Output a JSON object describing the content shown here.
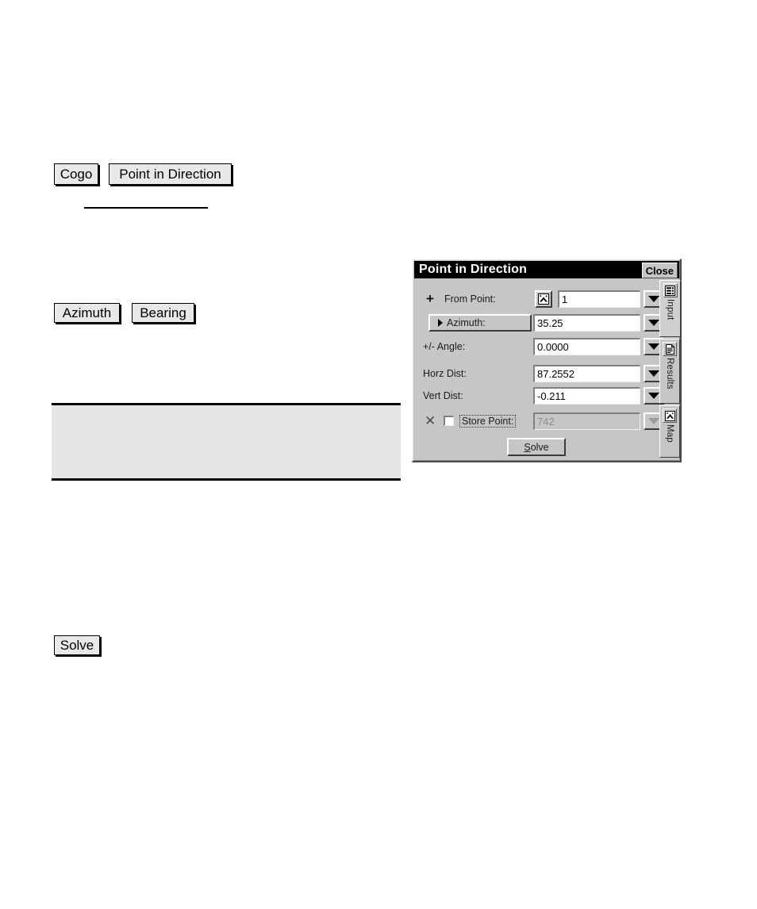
{
  "page": {
    "background": "#ffffff"
  },
  "doc_buttons": [
    {
      "name": "cogo-button",
      "label": "Cogo"
    },
    {
      "name": "point-in-direction-button",
      "label": "Point in Direction"
    },
    {
      "name": "azimuth-button",
      "label": "Azimuth"
    },
    {
      "name": "bearing-button",
      "label": "Bearing"
    },
    {
      "name": "solve-button",
      "label": "Solve"
    }
  ],
  "note_box": {
    "text": ""
  },
  "dialog": {
    "title": "Point in Direction",
    "close_label": "Close",
    "colors": {
      "face": "#c6c6c6",
      "titlebar": "#000000",
      "title_text": "#ffffff",
      "field_bg": "#ffffff",
      "disabled_text": "#8d8d8d"
    },
    "rows": [
      {
        "marker": "+",
        "label": "From Point:",
        "icon": "map-pick-icon",
        "value": "1",
        "dropdown": true,
        "disabled": false
      },
      {
        "button_label": "Azimuth:",
        "value": "35.25",
        "dropdown": true,
        "disabled": false
      },
      {
        "label": "+/- Angle:",
        "value": "0.0000",
        "dropdown": true,
        "disabled": false
      },
      {
        "label": "Horz Dist:",
        "value": "87.2552",
        "dropdown": true,
        "disabled": false
      },
      {
        "label": "Vert Dist:",
        "value": "-0.211",
        "dropdown": true,
        "disabled": false
      },
      {
        "marker": "✕",
        "checkbox": false,
        "label": "Store Point:",
        "value": "742",
        "dropdown": true,
        "disabled": true
      }
    ],
    "solve": {
      "accel": "S",
      "rest": "olve",
      "label": "Solve"
    },
    "tabs": [
      {
        "label": "Input",
        "icon": "form-icon",
        "active": true
      },
      {
        "label": "Results",
        "icon": "document-icon",
        "active": false
      },
      {
        "label": "Map",
        "icon": "map-icon",
        "active": false
      }
    ]
  }
}
